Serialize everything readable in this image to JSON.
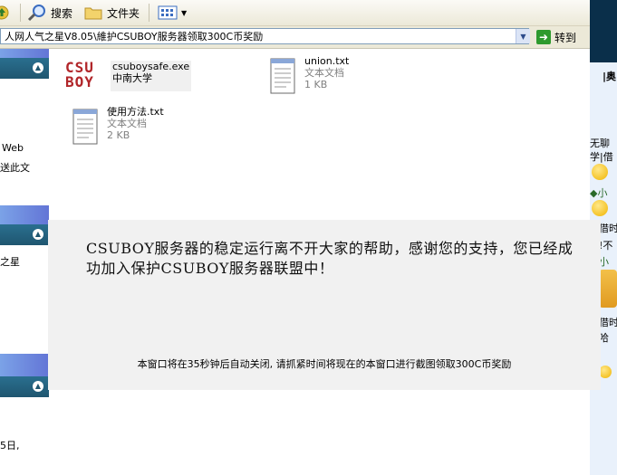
{
  "toolbar": {
    "search_label": "搜索",
    "folders_label": "文件夹"
  },
  "address": {
    "path": "人网人气之星V8.05\\維护CSUBOY服务器领取300C币奖励",
    "go_label": "转到"
  },
  "left_pane": {
    "texts": [
      "Web",
      "送此文",
      "之星",
      "5日,"
    ]
  },
  "files": [
    {
      "name": "csuboysafe.exe",
      "sub": "中南大学",
      "icon": "csuboy-logo-icon",
      "logo_line1": "CSU",
      "logo_line2": "BOY"
    },
    {
      "name": "union.txt",
      "sub": "文本文档",
      "size": "1 KB",
      "icon": "notepad-icon"
    },
    {
      "name": "使用方法.txt",
      "sub": "文本文档",
      "size": "2 KB",
      "icon": "notepad-icon"
    }
  ],
  "right_strip": {
    "texts": [
      "|奥",
      "无聊",
      "学|借",
      "◆小",
      "借时",
      "!不",
      "小",
      "借时",
      "哈"
    ]
  },
  "popup": {
    "message": "CSUBOY服务器的稳定运行离不开大家的帮助，感谢您的支持，您已经成功加入保护CSUBOY服务器联盟中！",
    "note": "本窗口将在35秒钟后自动关闭, 请抓紧时间将现在的本窗口进行截图领取300C币奖励"
  },
  "colors": {
    "popup_bg": "#f1f1f1",
    "logo_red": "#b1262a",
    "pane_header": "#1f5670",
    "go_green": "#2e9a2e"
  }
}
